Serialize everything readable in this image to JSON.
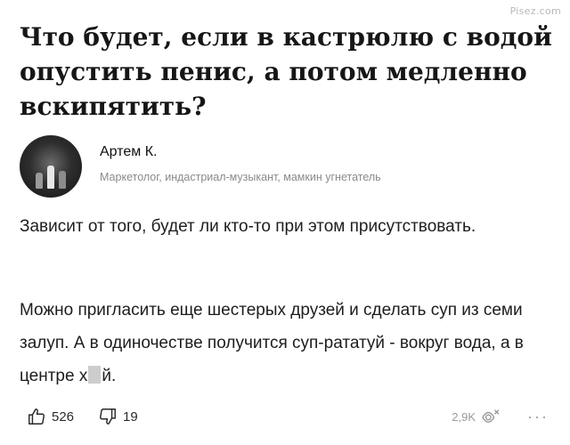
{
  "watermark": "Pisez.com",
  "question": {
    "title": "Что будет, если в кастрюлю с водой опустить пенис, а потом медленно вскипятить?"
  },
  "author": {
    "name": "Артем К.",
    "description": "Маркетолог, индастриал-музыкант, мамкин угнетатель",
    "avatar_icon": "avatar-photo"
  },
  "answer": {
    "paragraph1": "Зависит от того, будет ли кто-то при этом присутствовать.",
    "paragraph2_before": "Можно пригласить еще шестерых друзей и сделать суп из семи залуп. А в одиночестве получится суп-рататуй - вокруг вода, а в центре х",
    "paragraph2_after": "й."
  },
  "footer": {
    "likes": "526",
    "dislikes": "19",
    "views": "2,9K",
    "more": "···",
    "icons": {
      "like": "thumbs-up-icon",
      "dislike": "thumbs-down-icon",
      "views": "eye-icon",
      "more": "more-icon"
    }
  },
  "colors": {
    "text": "#1d1d1d",
    "muted": "#8a8a8a",
    "icon": "#9a9a9a"
  }
}
